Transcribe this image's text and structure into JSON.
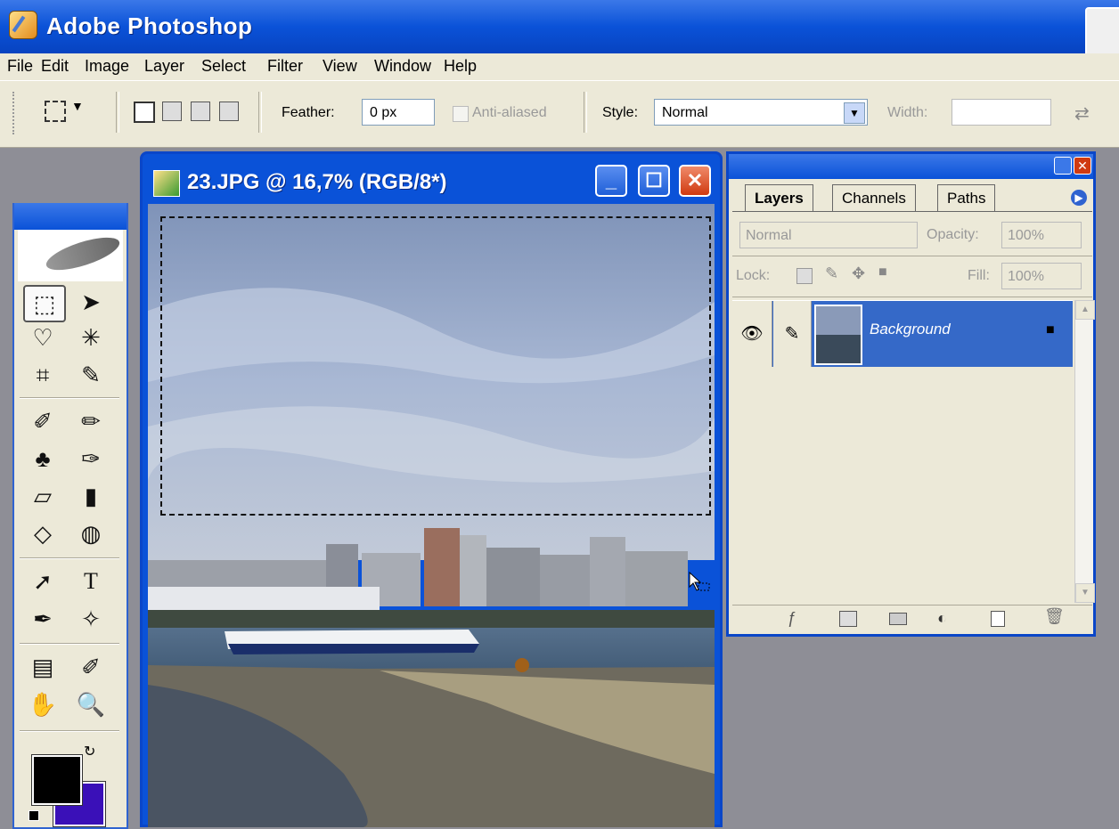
{
  "app": {
    "title": "Adobe Photoshop"
  },
  "menu": {
    "items": [
      "File",
      "Edit",
      "Image",
      "Layer",
      "Select",
      "Filter",
      "View",
      "Window",
      "Help"
    ]
  },
  "options": {
    "feather_label": "Feather:",
    "feather_value": "0 px",
    "antialias_label": "Anti-aliased",
    "style_label": "Style:",
    "style_value": "Normal",
    "width_label": "Width:",
    "width_value": ""
  },
  "document": {
    "title": "23.JPG @ 16,7% (RGB/8*)"
  },
  "toolbox": {
    "tools": [
      "rectangular-marquee",
      "move",
      "lasso",
      "magic-wand",
      "crop",
      "slice",
      "healing-brush",
      "brush",
      "clone-stamp",
      "history-brush",
      "eraser",
      "gradient",
      "blur",
      "dodge",
      "path-selection",
      "type",
      "pen",
      "custom-shape",
      "notes",
      "eyedropper",
      "hand",
      "zoom"
    ],
    "foreground_color": "#000000",
    "background_color": "#3a10b8"
  },
  "layers_palette": {
    "tabs": [
      "Layers",
      "Channels",
      "Paths"
    ],
    "active_tab": "Layers",
    "blend_mode": "Normal",
    "opacity_label": "Opacity:",
    "opacity_value": "100%",
    "lock_label": "Lock:",
    "fill_label": "Fill:",
    "fill_value": "100%",
    "layers": [
      {
        "name": "Background",
        "visible": true,
        "locked": true,
        "selected": true
      }
    ]
  },
  "colors": {
    "title_blue": "#0a52d8",
    "panel": "#ece9d8",
    "selected_layer": "#3569c8"
  }
}
